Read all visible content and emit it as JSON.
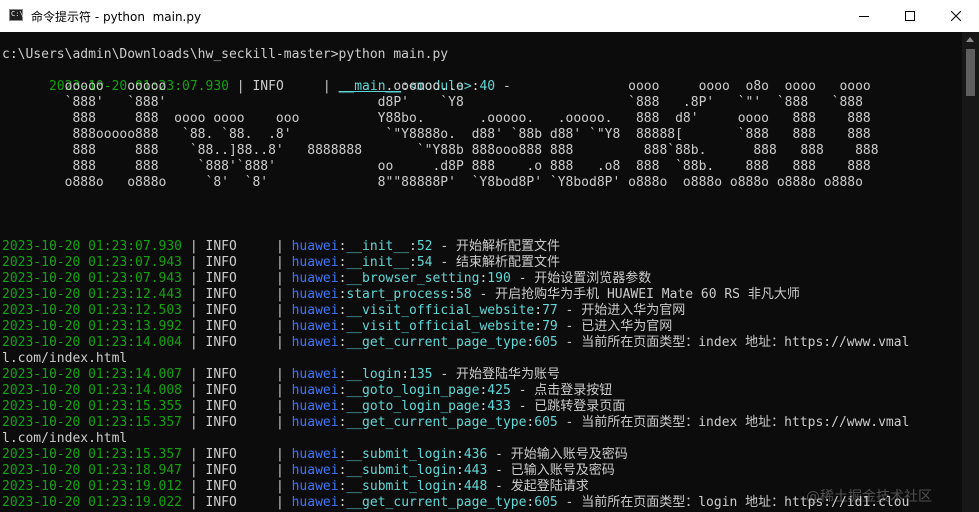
{
  "window": {
    "app_icon_text": "C:\\.",
    "title": "命令提示符 - python  main.py"
  },
  "command_line": "c:\\Users\\admin\\Downloads\\hw_seckill-master>python main.py",
  "first_log": {
    "timestamp": "2023-10-20 01:23:07.930",
    "sep1": " | ",
    "level": "INFO    ",
    "sep2": " | ",
    "module": "__main__",
    "colon1": ":",
    "func": "<module>",
    "colon2": ":",
    "line_no": "40",
    "dash": " - "
  },
  "banner": [
    "        ooooo   ooooo                            .oooooo..o                     oooo     oooo  o8o  oooo   oooo",
    "        `888'   `888'                           d8P'    `Y8                     `888   .8P'   `\"'  `888   `888",
    "         888     888  oooo oooo    ooo          Y88bo.       .ooooo.   .ooooo.   888  d8'     oooo   888    888",
    "         888ooooo888   `88. `88.  .8'            `\"Y8888o.  d88' `88b d88' `\"Y8  88888[       `888   888    888",
    "         888     888    `88..]88..8'   8888888       `\"Y88b 888ooo888 888         888`88b.      888   888    888",
    "         888     888     `888'`888'             oo     .d8P 888    .o 888   .o8  888  `88b.    888   888    888",
    "        o888o   o888o     `8'  `8'              8\"\"88888P'  `Y8bod8P' `Y8bod8P' o888o  o888o o888o o888o o888o"
  ],
  "logs": [
    {
      "timestamp": "2023-10-20 01:23:07.930",
      "sep1": " | ",
      "level": "INFO    ",
      "sep2": " | ",
      "module": "huawei",
      "colon1": ":",
      "func": "__init__",
      "colon2": ":",
      "line_no": "52",
      "dash": " - ",
      "message": "开始解析配置文件"
    },
    {
      "timestamp": "2023-10-20 01:23:07.943",
      "sep1": " | ",
      "level": "INFO    ",
      "sep2": " | ",
      "module": "huawei",
      "colon1": ":",
      "func": "__init__",
      "colon2": ":",
      "line_no": "54",
      "dash": " - ",
      "message": "结束解析配置文件"
    },
    {
      "timestamp": "2023-10-20 01:23:07.943",
      "sep1": " | ",
      "level": "INFO    ",
      "sep2": " | ",
      "module": "huawei",
      "colon1": ":",
      "func": "__browser_setting",
      "colon2": ":",
      "line_no": "190",
      "dash": " - ",
      "message": "开始设置浏览器参数"
    },
    {
      "timestamp": "2023-10-20 01:23:12.443",
      "sep1": " | ",
      "level": "INFO    ",
      "sep2": " | ",
      "module": "huawei",
      "colon1": ":",
      "func": "start_process",
      "colon2": ":",
      "line_no": "58",
      "dash": " - ",
      "message": "开启抢购华为手机 HUAWEI Mate 60 RS 非凡大师"
    },
    {
      "timestamp": "2023-10-20 01:23:12.503",
      "sep1": " | ",
      "level": "INFO    ",
      "sep2": " | ",
      "module": "huawei",
      "colon1": ":",
      "func": "__visit_official_website",
      "colon2": ":",
      "line_no": "77",
      "dash": " - ",
      "message": "开始进入华为官网"
    },
    {
      "timestamp": "2023-10-20 01:23:13.992",
      "sep1": " | ",
      "level": "INFO    ",
      "sep2": " | ",
      "module": "huawei",
      "colon1": ":",
      "func": "__visit_official_website",
      "colon2": ":",
      "line_no": "79",
      "dash": " - ",
      "message": "已进入华为官网"
    },
    {
      "timestamp": "2023-10-20 01:23:14.004",
      "sep1": " | ",
      "level": "INFO    ",
      "sep2": " | ",
      "module": "huawei",
      "colon1": ":",
      "func": "__get_current_page_type",
      "colon2": ":",
      "line_no": "605",
      "dash": " - ",
      "message": "当前所在页面类型：index 地址：https://www.vmal",
      "wrap": "l.com/index.html"
    },
    {
      "timestamp": "2023-10-20 01:23:14.007",
      "sep1": " | ",
      "level": "INFO    ",
      "sep2": " | ",
      "module": "huawei",
      "colon1": ":",
      "func": "__login",
      "colon2": ":",
      "line_no": "135",
      "dash": " - ",
      "message": "开始登陆华为账号"
    },
    {
      "timestamp": "2023-10-20 01:23:14.008",
      "sep1": " | ",
      "level": "INFO    ",
      "sep2": " | ",
      "module": "huawei",
      "colon1": ":",
      "func": "__goto_login_page",
      "colon2": ":",
      "line_no": "425",
      "dash": " - ",
      "message": "点击登录按钮"
    },
    {
      "timestamp": "2023-10-20 01:23:15.355",
      "sep1": " | ",
      "level": "INFO    ",
      "sep2": " | ",
      "module": "huawei",
      "colon1": ":",
      "func": "__goto_login_page",
      "colon2": ":",
      "line_no": "433",
      "dash": " - ",
      "message": "已跳转登录页面"
    },
    {
      "timestamp": "2023-10-20 01:23:15.357",
      "sep1": " | ",
      "level": "INFO    ",
      "sep2": " | ",
      "module": "huawei",
      "colon1": ":",
      "func": "__get_current_page_type",
      "colon2": ":",
      "line_no": "605",
      "dash": " - ",
      "message": "当前所在页面类型：index 地址：https://www.vmal",
      "wrap": "l.com/index.html"
    },
    {
      "timestamp": "2023-10-20 01:23:15.357",
      "sep1": " | ",
      "level": "INFO    ",
      "sep2": " | ",
      "module": "huawei",
      "colon1": ":",
      "func": "__submit_login",
      "colon2": ":",
      "line_no": "436",
      "dash": " - ",
      "message": "开始输入账号及密码"
    },
    {
      "timestamp": "2023-10-20 01:23:18.947",
      "sep1": " | ",
      "level": "INFO    ",
      "sep2": " | ",
      "module": "huawei",
      "colon1": ":",
      "func": "__submit_login",
      "colon2": ":",
      "line_no": "443",
      "dash": " - ",
      "message": "已输入账号及密码"
    },
    {
      "timestamp": "2023-10-20 01:23:19.012",
      "sep1": " | ",
      "level": "INFO    ",
      "sep2": " | ",
      "module": "huawei",
      "colon1": ":",
      "func": "__submit_login",
      "colon2": ":",
      "line_no": "448",
      "dash": " - ",
      "message": "发起登陆请求"
    },
    {
      "timestamp": "2023-10-20 01:23:19.022",
      "sep1": " | ",
      "level": "INFO    ",
      "sep2": " | ",
      "module": "huawei",
      "colon1": ":",
      "func": "__get_current_page_type",
      "colon2": ":",
      "line_no": "605",
      "dash": " - ",
      "message": "当前所在页面类型：login 地址：https://id1.clou"
    }
  ],
  "watermark": "@稀土掘金技术社区",
  "colors": {
    "background": "#0c0c0c",
    "text": "#cccccc",
    "timestamp": "#13a10e",
    "module": "#3b78ff",
    "function": "#61d6d6"
  },
  "icons": {
    "minimize": "minimize-icon",
    "maximize": "maximize-icon",
    "close": "close-icon"
  }
}
